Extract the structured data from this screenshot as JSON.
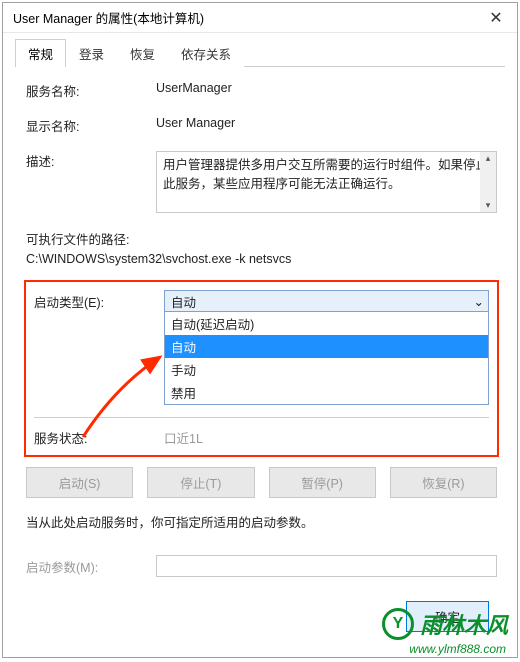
{
  "window": {
    "title": "User Manager 的属性(本地计算机)"
  },
  "tabs": {
    "general": "常规",
    "logon": "登录",
    "recovery": "恢复",
    "dependencies": "依存关系"
  },
  "general": {
    "service_name_label": "服务名称:",
    "service_name_value": "UserManager",
    "display_name_label": "显示名称:",
    "display_name_value": "User Manager",
    "description_label": "描述:",
    "description_value": "用户管理器提供多用户交互所需要的运行时组件。如果停止此服务，某些应用程序可能无法正确运行。",
    "exec_path_label": "可执行文件的路径:",
    "exec_path_value": "C:\\WINDOWS\\system32\\svchost.exe -k netsvcs",
    "startup_type_label": "启动类型(E):",
    "startup_type_value": "自动",
    "startup_options": {
      "delayed": "自动(延迟启动)",
      "auto": "自动",
      "manual": "手动",
      "disabled": "禁用"
    },
    "service_status_label": "服务状态:",
    "service_status_value_partial": "口近1L",
    "buttons": {
      "start": "启动(S)",
      "stop": "停止(T)",
      "pause": "暂停(P)",
      "resume": "恢复(R)"
    },
    "hint": "当从此处启动服务时，你可指定所适用的启动参数。",
    "start_params_label": "启动参数(M):"
  },
  "dialog_buttons": {
    "ok": "确定"
  },
  "watermark": {
    "brand": "雨林木风",
    "url": "www.ylmf888.com",
    "logo_char": "Y"
  }
}
